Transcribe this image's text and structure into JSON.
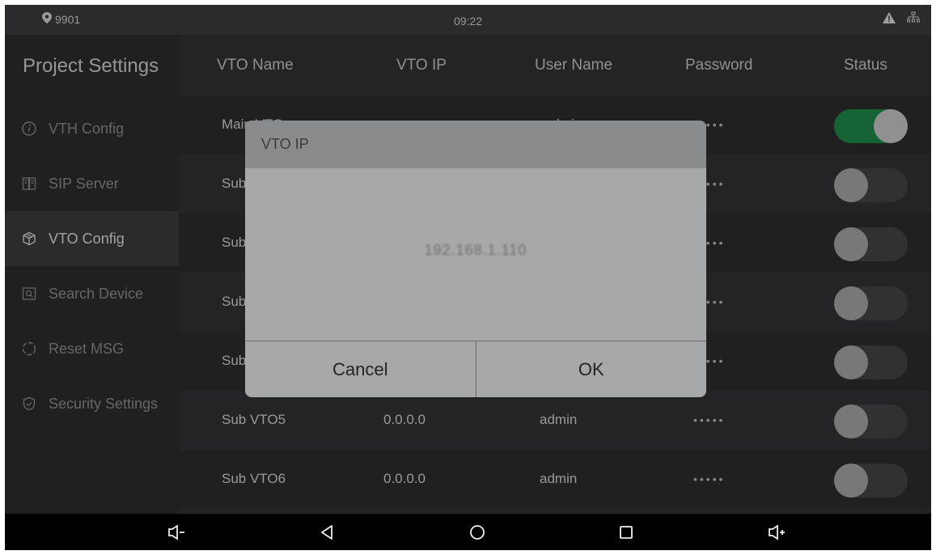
{
  "status_bar": {
    "location": "9901",
    "time": "09:22",
    "icons": [
      "warning-icon",
      "network-icon"
    ]
  },
  "sidebar": {
    "title": "Project Settings",
    "items": [
      {
        "label": "VTH Config",
        "icon": "info-icon"
      },
      {
        "label": "SIP Server",
        "icon": "server-icon"
      },
      {
        "label": "VTO Config",
        "icon": "cube-icon"
      },
      {
        "label": "Search Device",
        "icon": "search-icon"
      },
      {
        "label": "Reset MSG",
        "icon": "reset-icon"
      },
      {
        "label": "Security Settings",
        "icon": "shield-icon"
      }
    ],
    "active_index": 2
  },
  "table": {
    "headers": [
      "VTO Name",
      "VTO IP",
      "User Name",
      "Password",
      "Status"
    ],
    "rows": [
      {
        "name": "Main VTO",
        "ip": "",
        "user": "admin",
        "password": "•••••",
        "status": true
      },
      {
        "name": "Sub VTO1",
        "ip": "",
        "user": "",
        "password": "•••••",
        "status": false
      },
      {
        "name": "Sub VTO2",
        "ip": "",
        "user": "",
        "password": "•••••",
        "status": false
      },
      {
        "name": "Sub VTO3",
        "ip": "",
        "user": "",
        "password": "•••••",
        "status": false
      },
      {
        "name": "Sub VTO4",
        "ip": "",
        "user": "",
        "password": "•••••",
        "status": false
      },
      {
        "name": "Sub VTO5",
        "ip": "0.0.0.0",
        "user": "admin",
        "password": "•••••",
        "status": false
      },
      {
        "name": "Sub VTO6",
        "ip": "0.0.0.0",
        "user": "admin",
        "password": "•••••",
        "status": false
      }
    ]
  },
  "dialog": {
    "title": "VTO IP",
    "value": "192.168.1.110",
    "cancel_label": "Cancel",
    "ok_label": "OK"
  },
  "nav_bar": {
    "buttons": [
      "volume-down-icon",
      "back-icon",
      "home-icon",
      "recents-icon",
      "volume-up-icon"
    ]
  },
  "colors": {
    "toggle_on": "#1f8a4a",
    "toggle_off": "#444444",
    "background": "#333336"
  }
}
